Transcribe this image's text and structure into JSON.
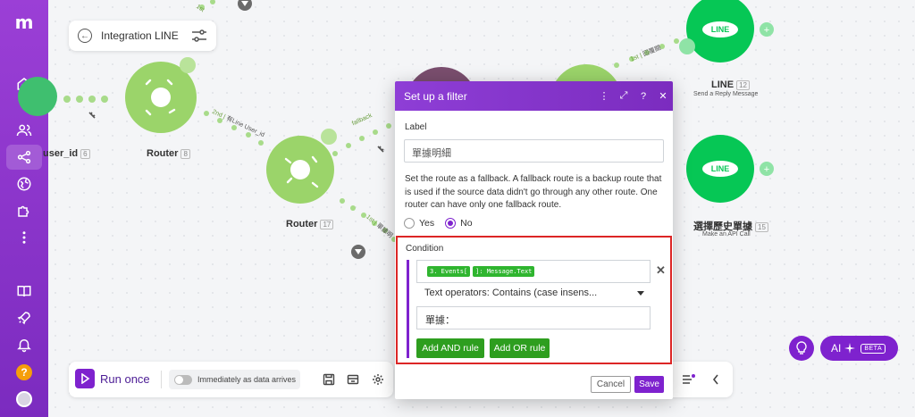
{
  "colors": {
    "brand": "#7e22ce",
    "node_router": "#9bd46a",
    "node_line": "#06c755",
    "highlight": "#dc2626",
    "tag_green": "#2fb52f",
    "button_green": "#2e9e1f"
  },
  "sidebar": {
    "logo": "m",
    "items": [
      {
        "name": "home",
        "icon": "home-icon"
      },
      {
        "name": "team",
        "icon": "users-icon"
      },
      {
        "name": "scenarios",
        "icon": "share-icon",
        "active": true
      },
      {
        "name": "connections",
        "icon": "globe-icon"
      },
      {
        "name": "apps",
        "icon": "puzzle-icon"
      },
      {
        "name": "more",
        "icon": "more-vertical-icon"
      },
      {
        "name": "docs",
        "icon": "book-icon"
      },
      {
        "name": "launch",
        "icon": "rocket-icon"
      },
      {
        "name": "notifications",
        "icon": "bell-icon"
      }
    ],
    "help": "?"
  },
  "scenario": {
    "title": "Integration LINE"
  },
  "nodes": {
    "left_node_label": "user_id",
    "left_node_id": "6",
    "router1_label": "Router",
    "router1_id": "8",
    "router2_label": "Router",
    "router2_id": "17",
    "line1_label": "LINE",
    "line1_id": "12",
    "line1_sub": "Send a Reply Message",
    "line2_label": "選擇歷史單據",
    "line2_id": "15",
    "line2_sub": "Make an API Call",
    "line_logo_text": "LINE"
  },
  "route_tags": {
    "second": "2nd",
    "second_extra": "有Line User_id",
    "fallback": "fallback",
    "first_top": "1st",
    "first_right": "1st",
    "first_right_extra": "回覆關",
    "first_lower": "1st",
    "first_lower_extra": "單據明"
  },
  "filter_modal": {
    "title": "Set up a filter",
    "label_caption": "Label",
    "label_value": "單據明細",
    "fallback_text": "Set the route as a fallback. A fallback route is a backup route that is used if the source data didn't go through any other route. One router can have only one fallback route.",
    "yes": "Yes",
    "no": "No",
    "condition_caption": "Condition",
    "field_pill_1": "3. Events[",
    "field_pill_2": "]: Message.Text",
    "operator": "Text operators: Contains (case insens...",
    "value": "單據：",
    "add_and": "Add AND rule",
    "add_or": "Add OR rule",
    "cancel": "Cancel",
    "save": "Save"
  },
  "toolbar": {
    "run_once": "Run once",
    "schedule": "Immediately as data arrives"
  },
  "ai": {
    "label": "AI",
    "beta": "BETA"
  }
}
